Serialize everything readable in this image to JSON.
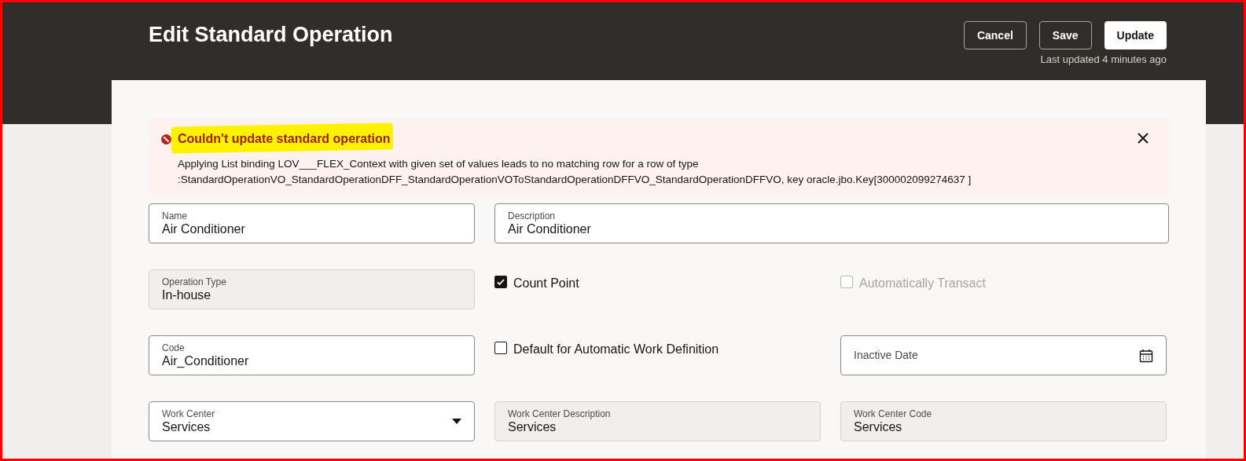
{
  "header": {
    "title": "Edit Standard Operation",
    "buttons": [
      {
        "label": "Cancel",
        "kind": "outline"
      },
      {
        "label": "Save",
        "kind": "outline"
      },
      {
        "label": "Update",
        "kind": "primary"
      }
    ],
    "last_updated": "Last updated 4 minutes ago"
  },
  "error": {
    "title": "Couldn't update standard operation",
    "highlighted": true,
    "message_lines": [
      "Applying List binding LOV___FLEX_Context with given set of values leads to no matching row for a row of type",
      ":StandardOperationVO_StandardOperationDFF_StandardOperationVOToStandardOperationDFFVO_StandardOperationDFFVO, key oracle.jbo.Key[300002099274637 ]"
    ]
  },
  "rows": [
    [
      {
        "kind": "text",
        "label": "Name",
        "value": "Air Conditioner"
      },
      {
        "kind": "text",
        "label": "Description",
        "value": "Air Conditioner"
      }
    ],
    [
      {
        "kind": "readonly",
        "label": "Operation Type",
        "value": "In-house"
      },
      {
        "kind": "checkbox",
        "label": "Count Point",
        "checked": true,
        "disabled": false
      },
      {
        "kind": "checkbox",
        "label": "Automatically Transact",
        "checked": false,
        "disabled": true
      }
    ],
    [
      {
        "kind": "text",
        "label": "Code",
        "value": "Air_Conditioner"
      },
      {
        "kind": "checkbox",
        "label": "Default for Automatic Work Definition",
        "checked": false,
        "disabled": false
      },
      {
        "kind": "date",
        "label": "Inactive Date"
      }
    ],
    [
      {
        "kind": "select",
        "label": "Work Center",
        "value": "Services"
      },
      {
        "kind": "readonly",
        "label": "Work Center Description",
        "value": "Services"
      },
      {
        "kind": "readonly",
        "label": "Work Center Code",
        "value": "Services"
      }
    ]
  ]
}
